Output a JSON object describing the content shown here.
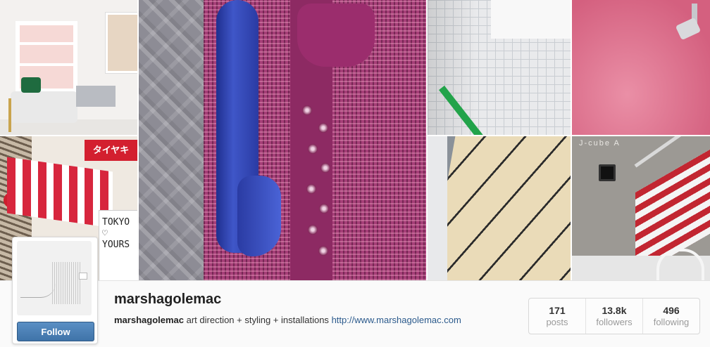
{
  "profile": {
    "username": "marshagolemac",
    "bio_username": "marshagolemac",
    "bio_text": " art direction + styling + installations ",
    "website": "http://www.marshagolemac.com",
    "follow_label": "Follow"
  },
  "stats": [
    {
      "value": "171",
      "label": "posts"
    },
    {
      "value": "13.8k",
      "label": "followers"
    },
    {
      "value": "496",
      "label": "following"
    }
  ],
  "tiles": {
    "shop_sign": "タイヤキ",
    "board_text": "TOKYO\n♡\nYOURS",
    "jcube_label": "J-cube A"
  },
  "colors": {
    "follow_button": "#3f73a8",
    "link": "#2b5a8c"
  }
}
